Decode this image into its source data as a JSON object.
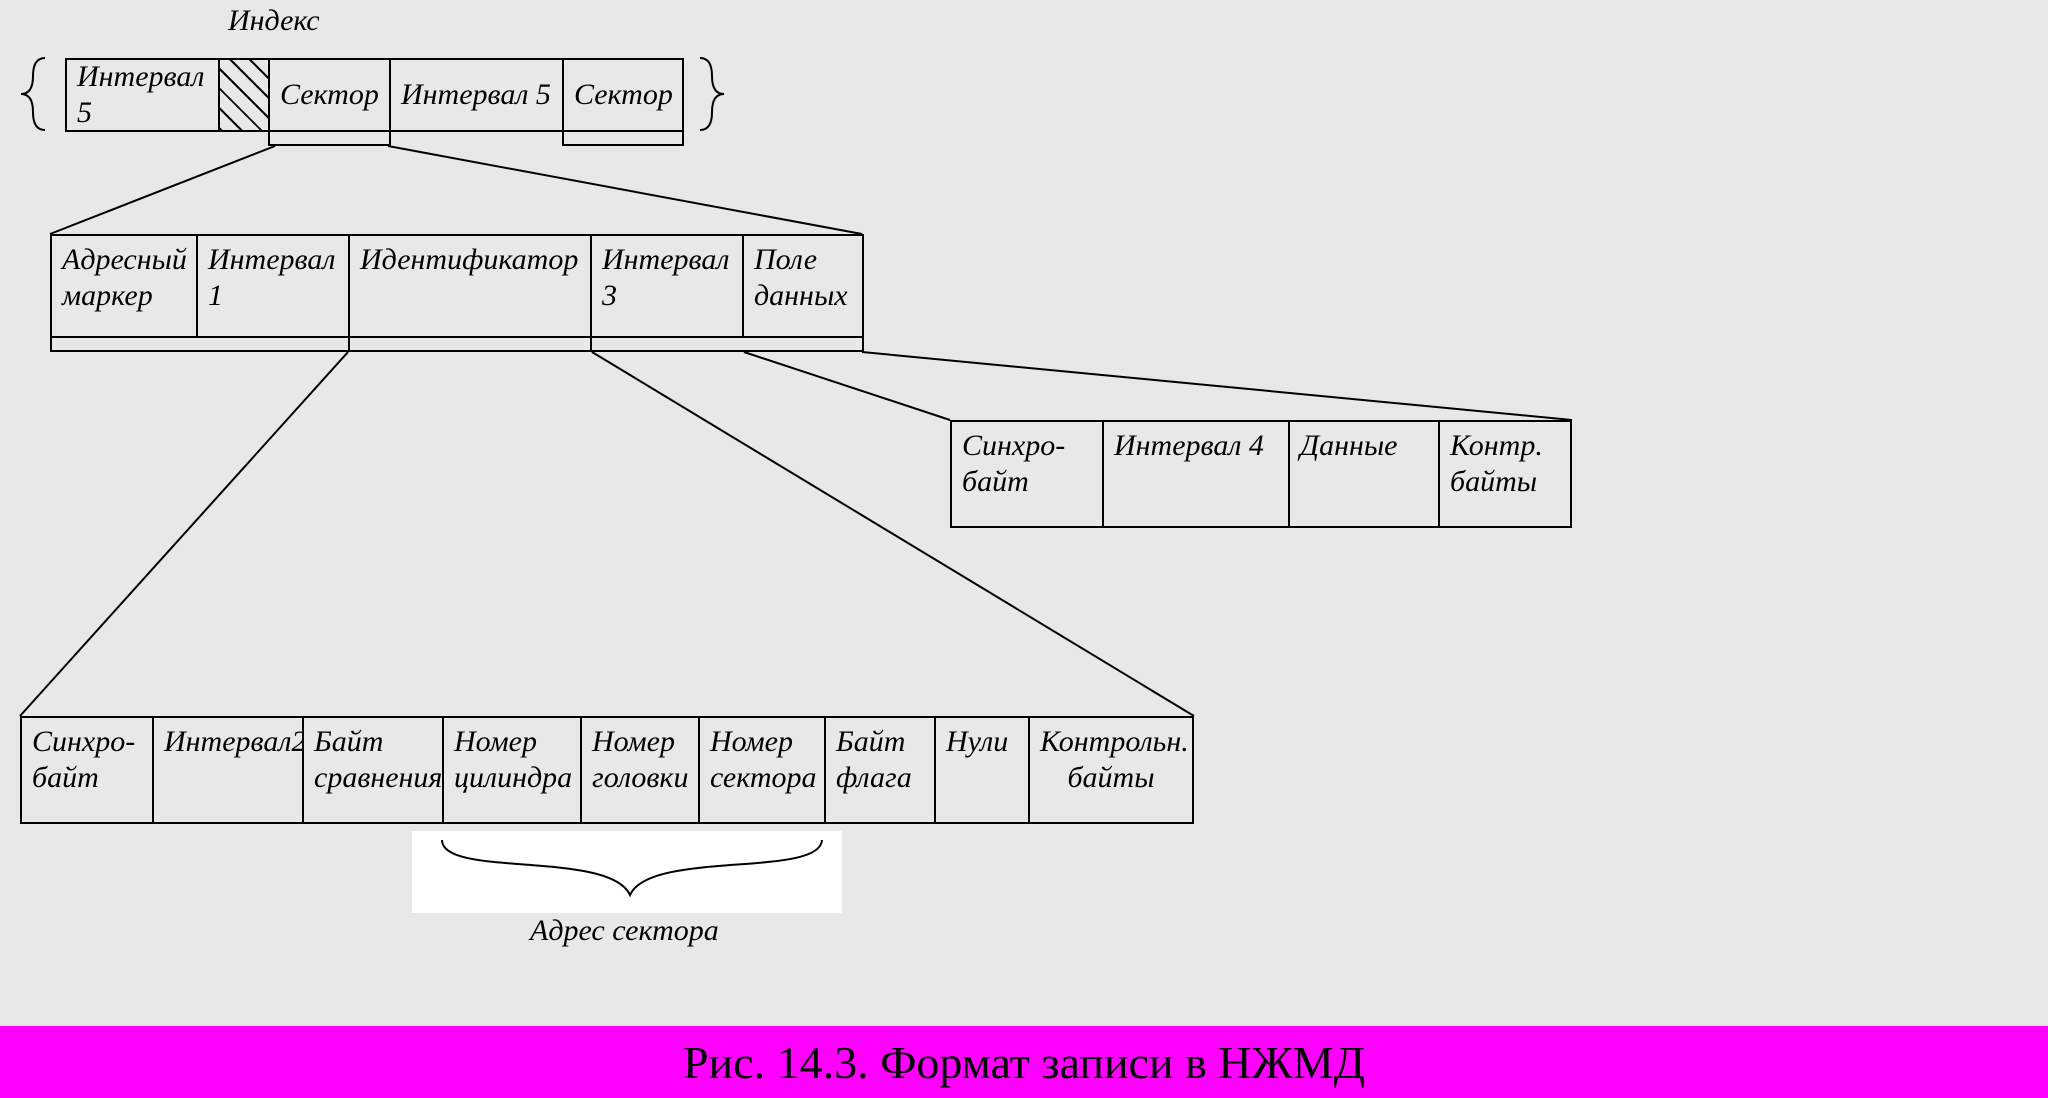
{
  "labels": {
    "index": "Индекс",
    "sector_addr": "Адрес сектора",
    "caption": "Рис. 14.3. Формат записи в НЖМД"
  },
  "row1": {
    "interval5a": "Интервал 5",
    "sector_a": "Сектор",
    "interval5b": "Интервал 5",
    "sector_b": "Сектор"
  },
  "row2": {
    "addr_marker1": "Адресный",
    "addr_marker2": "маркер",
    "interval1": "Интервал 1",
    "identifier": "Идентификатор",
    "interval3": "Интервал 3",
    "data_field1": "Поле",
    "data_field2": "данных"
  },
  "row3": {
    "sync1": "Синхро-",
    "sync2": "байт",
    "interval4": "Интервал 4",
    "data": "Данные",
    "ctrl1": "Контр.",
    "ctrl2": "байты"
  },
  "row4": {
    "sync1": "Синхро-",
    "sync2": "байт",
    "interval2": "Интервал2",
    "cmp1": "Байт",
    "cmp2": "сравнения",
    "cyl1": "Номер",
    "cyl2": "цилиндра",
    "head1": "Номер",
    "head2": "головки",
    "sect1": "Номер",
    "sect2": "сектора",
    "flag1": "Байт",
    "flag2": "флага",
    "zeros": "Нули",
    "ctrl1": "Контрольн.",
    "ctrl2": "байты"
  }
}
